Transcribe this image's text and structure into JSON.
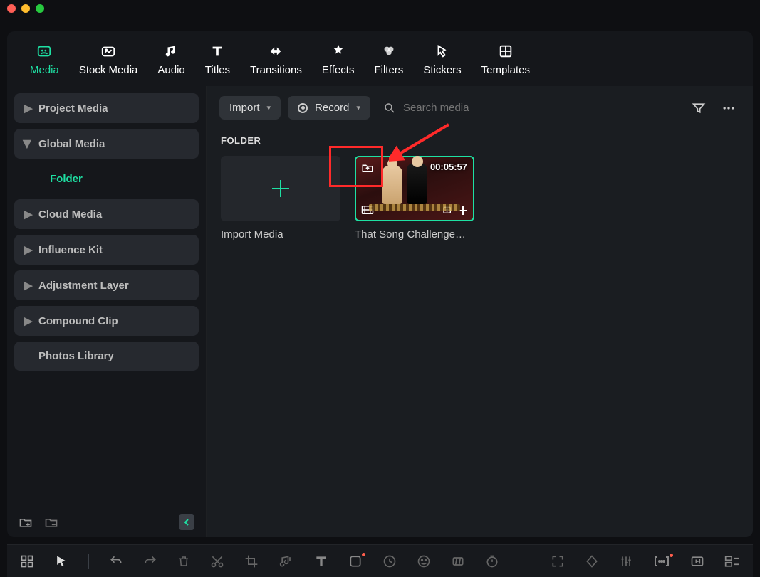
{
  "tabs": {
    "media": "Media",
    "stock_media": "Stock Media",
    "audio": "Audio",
    "titles": "Titles",
    "transitions": "Transitions",
    "effects": "Effects",
    "filters": "Filters",
    "stickers": "Stickers",
    "templates": "Templates"
  },
  "sidebar": {
    "project_media": "Project Media",
    "global_media": "Global Media",
    "folder": "Folder",
    "cloud_media": "Cloud Media",
    "influence_kit": "Influence Kit",
    "adjustment_layer": "Adjustment Layer",
    "compound_clip": "Compound Clip",
    "photos_library": "Photos Library"
  },
  "toolbar": {
    "import": "Import",
    "record": "Record",
    "search_placeholder": "Search media"
  },
  "content": {
    "section_title": "FOLDER",
    "import_media": "Import Media",
    "clip_name": "That Song Challenge…",
    "clip_duration": "00:05:57"
  }
}
